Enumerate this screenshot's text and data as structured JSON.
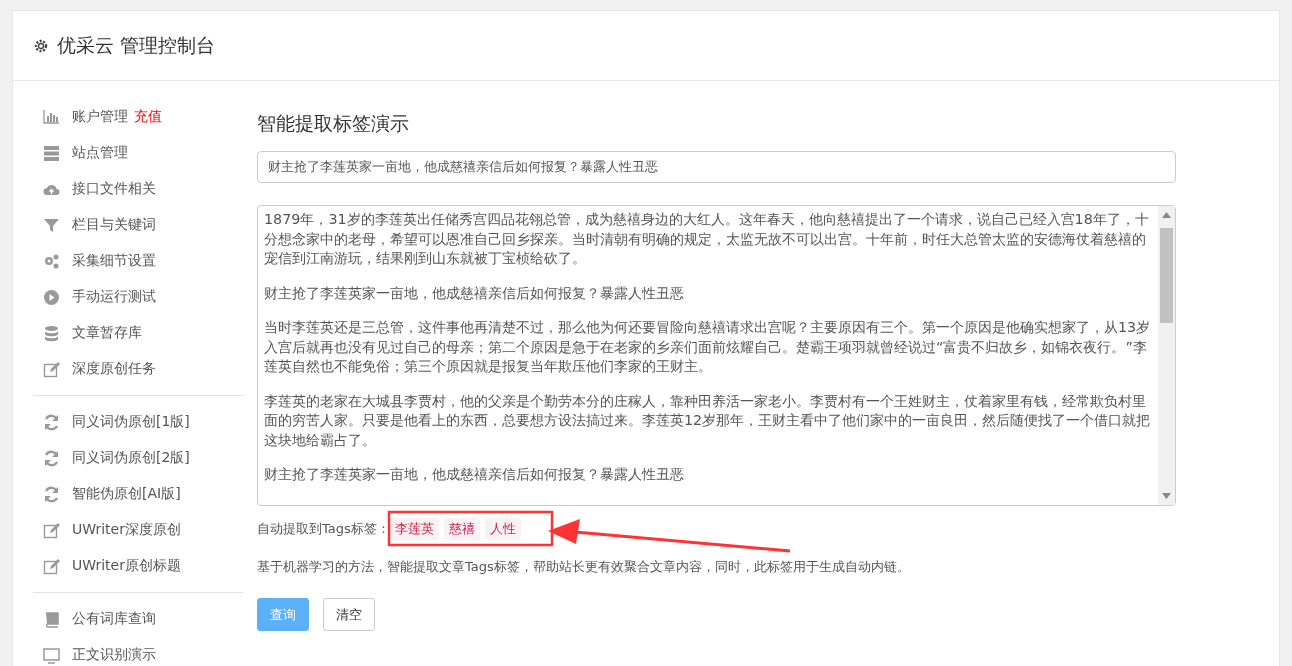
{
  "header": {
    "title": "优采云 管理控制台"
  },
  "sidebar": {
    "groups": [
      {
        "items": [
          {
            "label": "账户管理",
            "badge": "充值"
          },
          {
            "label": "站点管理"
          },
          {
            "label": "接口文件相关"
          },
          {
            "label": "栏目与关键词"
          },
          {
            "label": "采集细节设置"
          },
          {
            "label": "手动运行测试"
          },
          {
            "label": "文章暂存库"
          },
          {
            "label": "深度原创任务"
          }
        ]
      },
      {
        "items": [
          {
            "label": "同义词伪原创[1版]"
          },
          {
            "label": "同义词伪原创[2版]"
          },
          {
            "label": "智能伪原创[AI版]"
          },
          {
            "label": "UWriter深度原创"
          },
          {
            "label": "UWriter原创标题"
          }
        ]
      },
      {
        "items": [
          {
            "label": "公有词库查询"
          },
          {
            "label": "正文识别演示"
          }
        ]
      }
    ]
  },
  "main": {
    "heading": "智能提取标签演示",
    "title_field": {
      "value": "财主抢了李莲英家一亩地，他成慈禧亲信后如何报复？暴露人性丑恶"
    },
    "content_field": {
      "paragraphs": [
        "1879年，31岁的李莲英出任储秀宫四品花翎总管，成为慈禧身边的大红人。这年春天，他向慈禧提出了一个请求，说自己已经入宫18年了，十分想念家中的老母，希望可以恩准自己回乡探亲。当时清朝有明确的规定，太监无故不可以出宫。十年前，时任大总管太监的安德海仗着慈禧的宠信到江南游玩，结果刚到山东就被丁宝桢给砍了。",
        "财主抢了李莲英家一亩地，他成慈禧亲信后如何报复？暴露人性丑恶",
        "当时李莲英还是三总管，这件事他再清楚不过，那么他为何还要冒险向慈禧请求出宫呢？主要原因有三个。第一个原因是他确实想家了，从13岁入宫后就再也没有见过自己的母亲；第二个原因是急于在老家的乡亲们面前炫耀自己。楚霸王项羽就曾经说过“富贵不归故乡，如锦衣夜行。”李莲英自然也不能免俗；第三个原因就是报复当年欺压他们李家的王财主。",
        "李莲英的老家在大城县李贾村，他的父亲是个勤劳本分的庄稼人，靠种田养活一家老小。李贾村有一个王姓财主，仗着家里有钱，经常欺负村里面的穷苦人家。只要是他看上的东西，总要想方设法搞过来。李莲英12岁那年，王财主看中了他们家中的一亩良田，然后随便找了一个借口就把这块地给霸占了。",
        "财主抢了李莲英家一亩地，他成慈禧亲信后如何报复？暴露人性丑恶"
      ]
    },
    "tags_label": "自动提取到Tags标签：",
    "tags": [
      "李莲英",
      "慈禧",
      "人性"
    ],
    "description": "基于机器学习的方法，智能提取文章Tags标签，帮助站长更有效聚合文章内容，同时，此标签用于生成自动内链。",
    "buttons": [
      {
        "label": "查询",
        "kind": "primary"
      },
      {
        "label": "清空",
        "kind": "default"
      }
    ]
  }
}
